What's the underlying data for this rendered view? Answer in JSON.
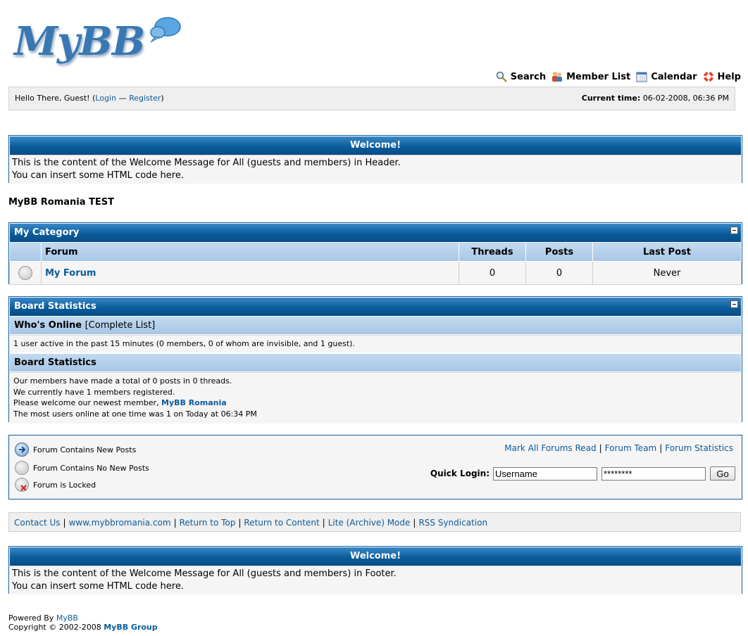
{
  "logo": {
    "text": "MyBB"
  },
  "top_menu": [
    {
      "label": "Search",
      "icon": "search-icon"
    },
    {
      "label": "Member List",
      "icon": "member-list-icon"
    },
    {
      "label": "Calendar",
      "icon": "calendar-icon"
    },
    {
      "label": "Help",
      "icon": "help-icon"
    }
  ],
  "welcome_bar": {
    "greeting": "Hello There, Guest! (",
    "login": "Login",
    "dash": " — ",
    "register": "Register",
    "close_paren": ")",
    "time_label": "Current time:",
    "time_value": "06-02-2008, 06:36 PM"
  },
  "header_welcome": {
    "title": "Welcome!",
    "line1": "This is the content of the Welcome Message for All (guests and members) in Header.",
    "line2": "You can insert some HTML code here."
  },
  "board_title": "MyBB Romania TEST",
  "category": {
    "title": "My Category",
    "columns": {
      "forum": "Forum",
      "threads": "Threads",
      "posts": "Posts",
      "last_post": "Last Post"
    },
    "forums": [
      {
        "name": "My Forum",
        "threads": "0",
        "posts": "0",
        "last_post": "Never"
      }
    ]
  },
  "stats": {
    "title": "Board Statistics",
    "whos_online": "Who's Online",
    "complete_list": "[Complete List]",
    "online_text": "1 user active in the past 15 minutes (0 members, 0 of whom are invisible, and 1 guest).",
    "stats_heading": "Board Statistics",
    "line1": "Our members have made a total of 0 posts in 0 threads.",
    "line2": "We currently have 1 members registered.",
    "line3_prefix": "Please welcome our newest member, ",
    "newest_member": "MyBB Romania",
    "line4": "The most users online at one time was 1 on Today at 06:34 PM"
  },
  "legend": {
    "new_posts": "Forum Contains New Posts",
    "no_new_posts": "Forum Contains No New Posts",
    "locked": "Forum is Locked"
  },
  "forum_links": {
    "mark_read": "Mark All Forums Read",
    "team": "Forum Team",
    "statistics": "Forum Statistics"
  },
  "quick_login": {
    "label": "Quick Login:",
    "username_value": "Username",
    "password_value": "********",
    "go": "Go"
  },
  "footer_links": [
    "Contact Us",
    "www.mybbromania.com",
    "Return to Top",
    "Return to Content",
    "Lite (Archive) Mode",
    "RSS Syndication"
  ],
  "footer_welcome": {
    "title": "Welcome!",
    "line1": "This is the content of the Welcome Message for All (guests and members) in Footer.",
    "line2": "You can insert some HTML code here."
  },
  "powered": {
    "prefix": "Powered By ",
    "mybb": "MyBB",
    "copyright": "Copyright © 2002-2008 ",
    "group": "MyBB Group"
  }
}
